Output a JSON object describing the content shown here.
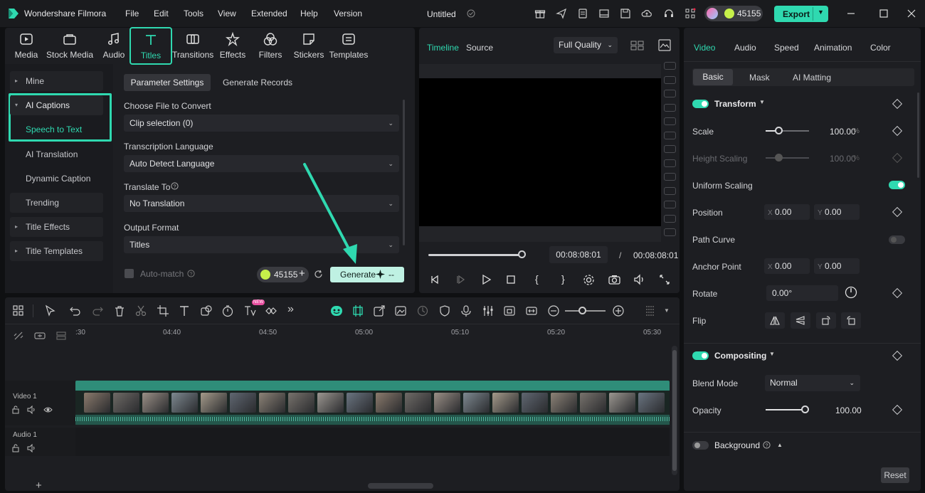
{
  "app": {
    "name": "Wondershare Filmora",
    "project_title": "Untitled",
    "credits": "45155",
    "export_label": "Export"
  },
  "menu": [
    "File",
    "Edit",
    "Tools",
    "View",
    "Extended",
    "Help",
    "Version"
  ],
  "media_tabs": [
    {
      "label": "Media",
      "icon": "media-icon"
    },
    {
      "label": "Stock Media",
      "icon": "stock-media-icon"
    },
    {
      "label": "Audio",
      "icon": "music-note-icon"
    },
    {
      "label": "Titles",
      "icon": "titles-icon",
      "active": true
    },
    {
      "label": "Transitions",
      "icon": "transitions-icon"
    },
    {
      "label": "Effects",
      "icon": "effects-icon"
    },
    {
      "label": "Filters",
      "icon": "filters-icon"
    },
    {
      "label": "Stickers",
      "icon": "stickers-icon"
    },
    {
      "label": "Templates",
      "icon": "templates-icon"
    }
  ],
  "sidebar": {
    "items": [
      {
        "label": "Mine",
        "arrow": "▸"
      },
      {
        "label": "AI Captions",
        "arrow": "▾"
      },
      {
        "label": "Speech to Text"
      },
      {
        "label": "AI Translation"
      },
      {
        "label": "Dynamic Caption"
      },
      {
        "label": "Trending"
      },
      {
        "label": "Title Effects",
        "arrow": "▸"
      },
      {
        "label": "Title Templates",
        "arrow": "▸"
      }
    ]
  },
  "stt": {
    "tabs": [
      "Parameter Settings",
      "Generate Records"
    ],
    "file_label": "Choose File to Convert",
    "file_value": "Clip selection (0)",
    "lang_label": "Transcription Language",
    "lang_value": "Auto Detect Language",
    "translate_label": "Translate To",
    "translate_value": "No Translation",
    "format_label": "Output Format",
    "format_value": "Titles",
    "automatch_label": "Auto-match",
    "credits": "45155",
    "generate_label": "Generate",
    "generate_cost": "--"
  },
  "player": {
    "tabs": [
      "Timeline",
      "Source"
    ],
    "quality": "Full Quality",
    "current_time": "00:08:08:01",
    "separator": "/",
    "total_time": "00:08:08:01",
    "progress": 1.0
  },
  "props": {
    "tabs": [
      "Video",
      "Audio",
      "Speed",
      "Animation",
      "Color"
    ],
    "subtabs": [
      "Basic",
      "Mask",
      "AI Matting"
    ],
    "transform": "Transform",
    "scale_label": "Scale",
    "scale_value": "100.00",
    "height_label": "Height Scaling",
    "height_value": "100.00",
    "pct": "%",
    "uniform_label": "Uniform Scaling",
    "position_label": "Position",
    "pos_x": "0.00",
    "pos_y": "0.00",
    "path_label": "Path Curve",
    "anchor_label": "Anchor Point",
    "anc_x": "0.00",
    "anc_y": "0.00",
    "rotate_label": "Rotate",
    "rotate_value": "0.00°",
    "flip_label": "Flip",
    "compositing": "Compositing",
    "blend_label": "Blend Mode",
    "blend_value": "Normal",
    "opacity_label": "Opacity",
    "opacity_value": "100.00",
    "background_label": "Background",
    "reset_label": "Reset",
    "x_key": "X",
    "y_key": "Y"
  },
  "timeline": {
    "ruler": [
      ":30",
      "04:40",
      "04:50",
      "05:00",
      "05:10",
      "05:20",
      "05:30"
    ],
    "video_track": "Video 1",
    "audio_track": "Audio 1",
    "new_badge": "NEW"
  },
  "colors": {
    "accent": "#2fd9b0",
    "panel": "#1d1e22",
    "bg": "#0f1012"
  }
}
